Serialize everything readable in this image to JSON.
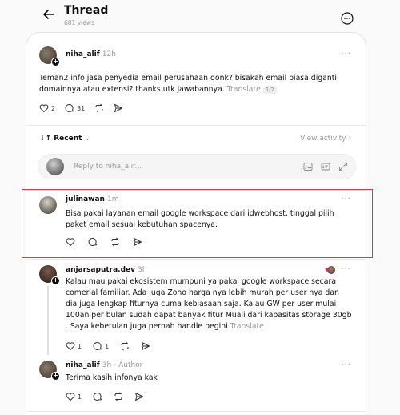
{
  "header": {
    "title": "Thread",
    "views": "681 views"
  },
  "original_post": {
    "username": "niha_alif",
    "time": "12h",
    "text": "Teman2 info jasa penyedia email perusahaan donk? bisakah email biasa diganti domainnya atau extensi? thanks utk jawabannya.",
    "translate": "Translate",
    "translate_badge": "1/2",
    "likes": "2",
    "replies": "31"
  },
  "sort": {
    "label": "Recent",
    "view_activity": "View activity"
  },
  "reply_box": {
    "placeholder": "Reply to niha_alif..."
  },
  "replies": [
    {
      "username": "julinawan",
      "time": "1m",
      "text": "Bisa pakai layanan email google workspace dari idwebhost, tinggal pilih paket email sesuai kebutuhan spacenya."
    },
    {
      "username": "anjarsaputra.dev",
      "time": "3h",
      "text": "Kalau mau pakai ekosistem mumpuni ya pakai google workspace secara comerial familiar. Ada juga Zoho harga nya lebih murah per user nya dan dia juga lengkap fiturnya cuma kebiasaan saja. Kalau GW per user mulai 100an per bulan sudah dapat banyak fitur Muali dari kapasitas storage 30gb . Saya kebetulan juga pernah handle begini",
      "translate": "Translate",
      "likes": "1",
      "replies": "1"
    },
    {
      "username": "niha_alif",
      "time": "3h",
      "author_tag": "· Author",
      "text": "Terima kasih infonya kak",
      "likes": "1"
    }
  ],
  "colors": {
    "highlight": "#e33333",
    "text": "#101010",
    "muted": "#999999"
  }
}
